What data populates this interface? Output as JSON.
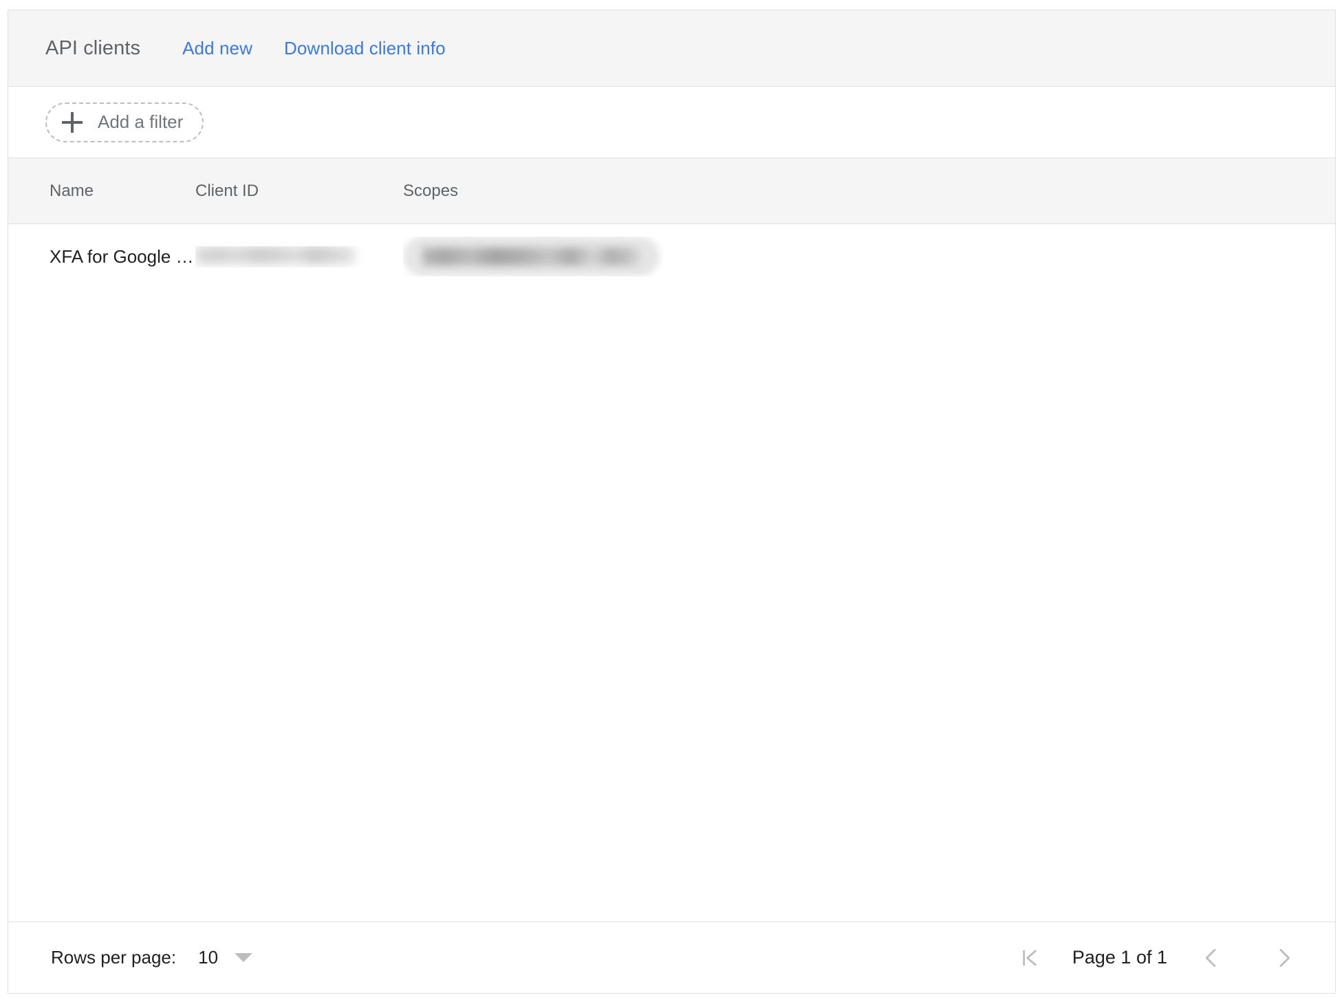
{
  "toolbar": {
    "title": "API clients",
    "add_new_label": "Add new",
    "download_label": "Download client info"
  },
  "filter_bar": {
    "add_filter_label": "Add a filter",
    "add_filter_icon": "plus-icon"
  },
  "table": {
    "columns": [
      "Name",
      "Client ID",
      "Scopes"
    ],
    "rows": [
      {
        "name": "XFA for Google …",
        "client_id": "",
        "scopes": ""
      }
    ]
  },
  "footer": {
    "rows_per_page_label": "Rows per page:",
    "rows_per_page_value": "10",
    "page_label": "Page 1 of 1",
    "first_page_icon": "first-page-icon",
    "prev_page_icon": "chevron-left-icon",
    "next_page_icon": "chevron-right-icon",
    "caret_icon": "caret-down-icon"
  },
  "colors": {
    "link": "#3b78e7",
    "title": "#5f6368",
    "text": "#202124",
    "border": "#e0e0e0",
    "header_bg": "#f5f5f5",
    "disabled_icon": "#bdbdbd"
  }
}
